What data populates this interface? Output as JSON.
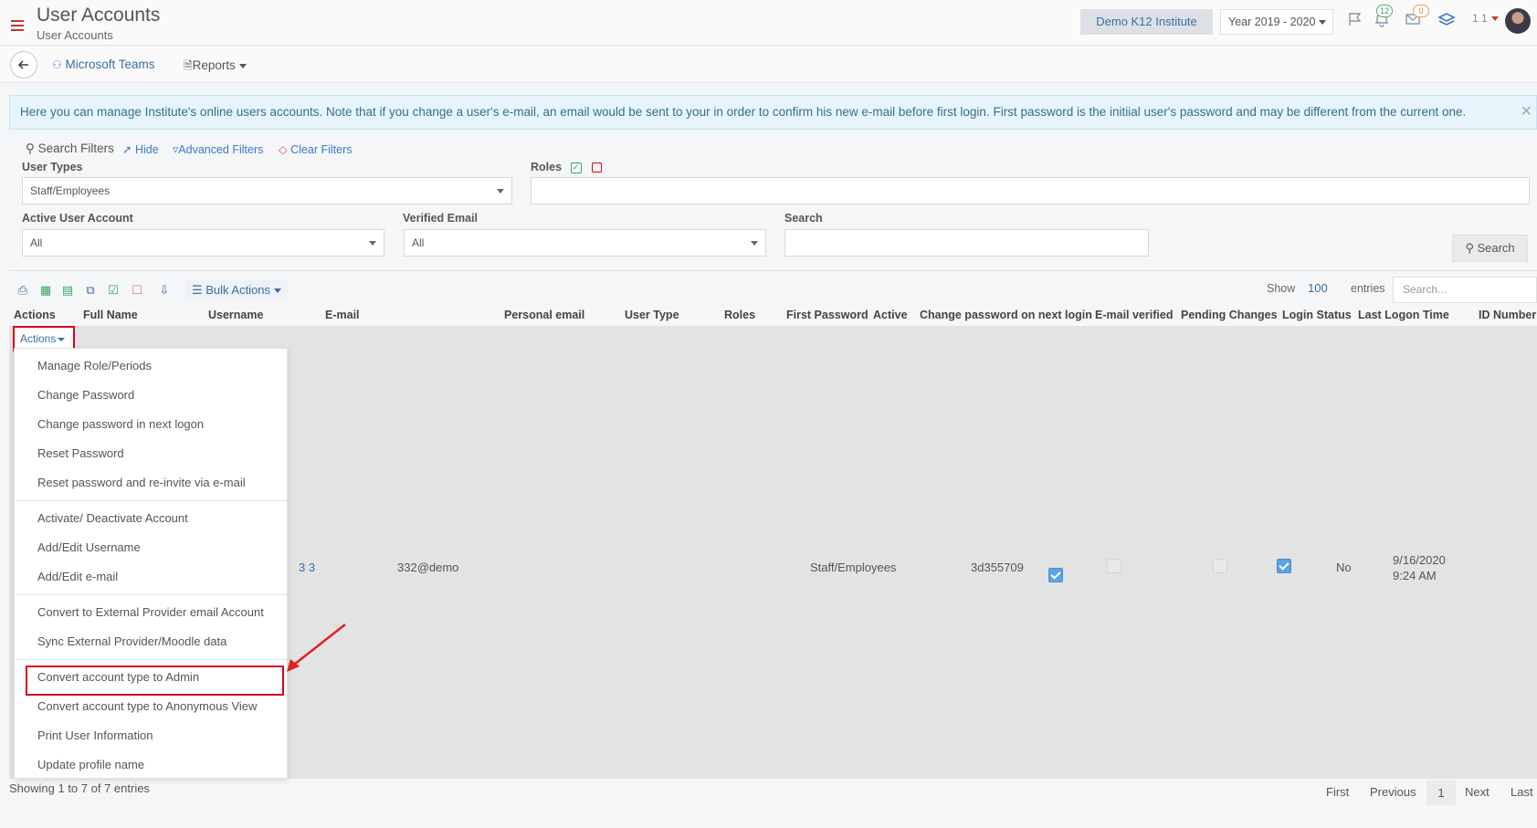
{
  "header": {
    "title": "User Accounts",
    "subtitle": "User Accounts",
    "institute": "Demo K12 Institute",
    "year": "Year 2019 - 2020",
    "notifications_count": "12",
    "messages_count": "0",
    "user_label": "1 1"
  },
  "nav": {
    "teams": "Microsoft Teams",
    "reports": "Reports"
  },
  "alert": {
    "text": "Here you can manage Institute's online users accounts. Note that if you change a user's e-mail, an email would be sent to your in order to confirm his new e-mail before first login. First password is the initiial user's password and may be different from the current one."
  },
  "filters": {
    "heading": "Search Filters",
    "hide": "Hide",
    "advanced": "Advanced Filters",
    "clear": "Clear Filters",
    "user_types_label": "User Types",
    "user_types_value": "Staff/Employees",
    "roles_label": "Roles",
    "active_label": "Active User Account",
    "active_value": "All",
    "verified_label": "Verified Email",
    "verified_value": "All",
    "search_label": "Search",
    "search_button": "Search"
  },
  "toolbar": {
    "bulk_actions": "Bulk Actions",
    "show": "Show",
    "entries_count": "100",
    "entries": "entries",
    "search_placeholder": "Search..."
  },
  "table": {
    "columns": [
      "Actions",
      "Full Name",
      "Username",
      "E-mail",
      "Personal email",
      "User Type",
      "Roles",
      "First Password",
      "Active",
      "Change password on next login",
      "E-mail verified",
      "Pending Changes",
      "Login Status",
      "Last Logon Time",
      "ID Number"
    ],
    "actions_button": "Actions",
    "row": {
      "full_name": "3 3",
      "username": "332@demo",
      "user_type": "Staff/Employees",
      "first_password": "3d355709",
      "active": true,
      "change_password": false,
      "email_verified": false,
      "pending_changes": true,
      "login_status": "No",
      "last_logon_date": "9/16/2020",
      "last_logon_time": "9:24 AM"
    }
  },
  "menu": {
    "items": [
      "Manage Role/Periods",
      "Change Password",
      "Change password in next logon",
      "Reset Password",
      "Reset password and re-invite via e-mail",
      "Activate/ Deactivate Account",
      "Add/Edit Username",
      "Add/Edit e-mail",
      "Convert to External Provider email Account",
      "Sync External Provider/Moodle data",
      "Convert account type to Admin",
      "Convert account type to Anonymous View",
      "Print User Information",
      "Update profile name"
    ]
  },
  "footer": {
    "info": "Showing 1 to 7 of 7 entries",
    "first": "First",
    "previous": "Previous",
    "current": "1",
    "next": "Next",
    "last": "Last"
  },
  "colors": {
    "link": "#3a6ea5",
    "highlight": "#d9001b",
    "accent_check": "#5aa4e6"
  }
}
